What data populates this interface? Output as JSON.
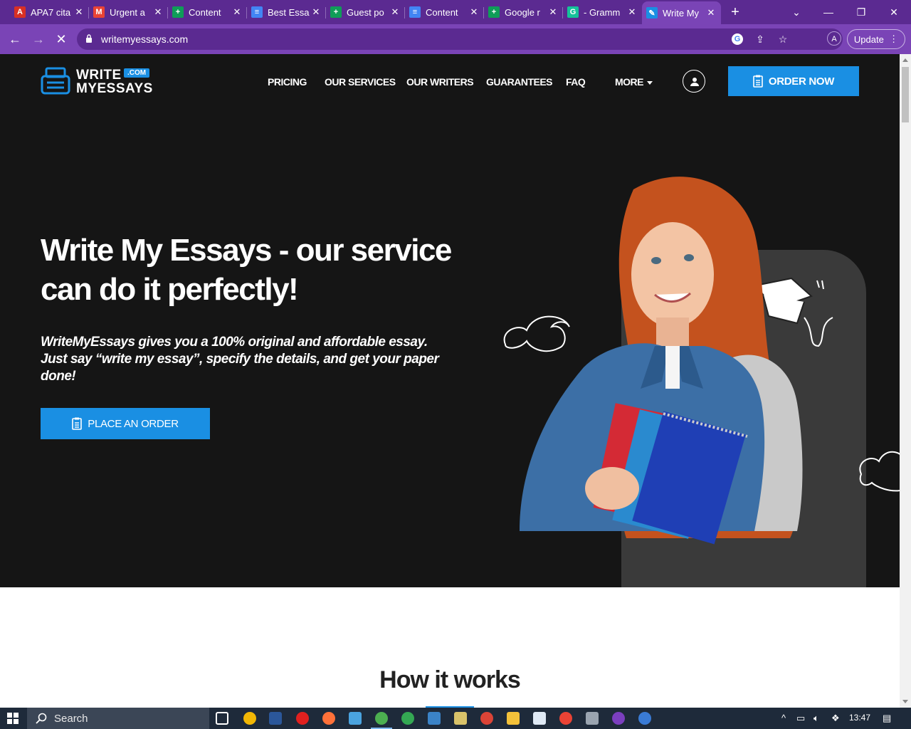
{
  "browser": {
    "tabs": [
      {
        "title": "APA7 cita",
        "favicon": "pdf-icon",
        "color": "#d93025"
      },
      {
        "title": "Urgent a",
        "favicon": "gmail-icon",
        "color": "#ea4335"
      },
      {
        "title": "Content",
        "favicon": "sheets-icon",
        "color": "#0f9d58"
      },
      {
        "title": "Best Essa",
        "favicon": "docs-icon",
        "color": "#4285f4"
      },
      {
        "title": "Guest po",
        "favicon": "sheets-icon",
        "color": "#0f9d58"
      },
      {
        "title": "Content",
        "favicon": "docs-icon",
        "color": "#4285f4"
      },
      {
        "title": "Google r",
        "favicon": "sheets-icon",
        "color": "#0f9d58"
      },
      {
        "title": "- Gramm",
        "favicon": "grammarly-icon",
        "color": "#15c39a"
      },
      {
        "title": "Write My",
        "favicon": "writemyessays-icon",
        "color": "#1a8fe3",
        "active": true
      }
    ],
    "url": "writemyessays.com",
    "profile_initial": "A",
    "update_label": "Update"
  },
  "site": {
    "logo": {
      "line1": "WRITE",
      "badge": ".COM",
      "line2": "MYESSAYS"
    },
    "nav": [
      "PRICING",
      "OUR SERVICES",
      "OUR WRITERS",
      "GUARANTEES",
      "FAQ",
      "MORE"
    ],
    "order_now_label": "ORDER NOW",
    "hero_title": "Write My Essays - our service can do it perfectly!",
    "hero_subtitle": "WriteMyEssays gives you a 100% original and affordable essay. Just say “write my essay”, specify the details, and get your paper done!",
    "place_order_label": "PLACE AN ORDER",
    "section_title": "How it works"
  },
  "taskbar": {
    "search_placeholder": "Search",
    "time": "13:47"
  },
  "colors": {
    "accent": "#1a8fe3",
    "hero_bg": "#151515",
    "browser_frame": "#7a44b6"
  }
}
